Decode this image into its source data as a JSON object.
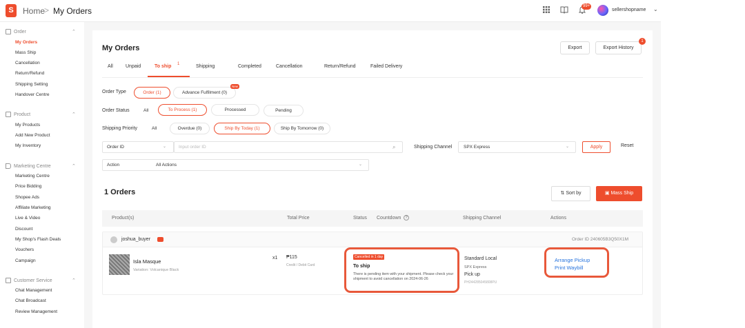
{
  "header": {
    "home": "Home",
    "separator": ">",
    "current": "My Orders",
    "badge": "99+",
    "username": "sellershopname"
  },
  "sidebar": {
    "sections": [
      {
        "title": "Order",
        "items": [
          "My Orders",
          "Mass Ship",
          "Cancellation",
          "Return/Refund",
          "Shipping Setting",
          "Handover Centre"
        ]
      },
      {
        "title": "Product",
        "items": [
          "My Products",
          "Add New Product",
          "My Inventory"
        ]
      },
      {
        "title": "Marketing Centre",
        "items": [
          "Marketing Centre",
          "Price Bidding",
          "Shopee Ads",
          "Affiliate Marketing",
          "Live & Video",
          "Discount",
          "My Shop's Flash Deals",
          "Vouchers",
          "Campaign"
        ]
      },
      {
        "title": "Customer Service",
        "items": [
          "Chat Management",
          "Chat Broadcast",
          "Review Management"
        ]
      }
    ]
  },
  "main": {
    "title": "My Orders",
    "export_label": "Export",
    "export_history_label": "Export History",
    "export_history_badge": "1",
    "tabs": [
      "All",
      "Unpaid",
      "To ship",
      "Shipping",
      "Completed",
      "Cancellation",
      "Return/Refund",
      "Failed Delivery"
    ],
    "tab_to_ship_badge": "1",
    "filters": {
      "order_type_label": "Order Type",
      "order_type_options": [
        "Order (1)",
        "Advance Fulfilment (0)"
      ],
      "new_badge": "New",
      "order_status_label": "Order Status",
      "order_status_options": [
        "All",
        "To Process (1)",
        "Processed",
        "Pending"
      ],
      "priority_label": "Shipping Priority",
      "priority_options": [
        "All",
        "Overdue (0)",
        "Ship By Today (1)",
        "Ship By Tomorrow (0)"
      ],
      "search_field": "Order ID",
      "search_placeholder": "Input order ID",
      "channel_label": "Shipping Channel",
      "channel_value": "SPX Express",
      "apply": "Apply",
      "reset": "Reset",
      "action_label": "Action",
      "action_value": "All Actions"
    },
    "orders_count": "1 Orders",
    "sort_by": "Sort by",
    "mass_ship": "Mass Ship",
    "table_headers": {
      "product": "Product(s)",
      "total": "Total Price",
      "status": "Status",
      "countdown": "Countdown",
      "channel": "Shipping Channel",
      "actions": "Actions"
    },
    "order": {
      "buyer": "joshua_buyer",
      "order_id": "Order ID 240605B3Q50X1M",
      "product_name": "Isla Masque",
      "variation": "Variation: Volcanique Black",
      "qty": "x1",
      "price": "₱115",
      "payment": "Credit / Debit Card",
      "cancel_tag": "Cancelled in 1 day",
      "status": "To ship",
      "status_desc": "There is pending item with your shipment. Please check your shipment to avoid cancellation on 2024-06-26",
      "channel_type": "Standard Local",
      "channel_courier": "SPX Express",
      "channel_method": "Pick up",
      "tracking": "PH244285045808PU",
      "action1": "Arrange Pickup",
      "action2": "Print Waybill"
    }
  },
  "colors": {
    "accent": "#ee4d2d",
    "link": "#2673dd",
    "highlight": "#e8583a"
  }
}
